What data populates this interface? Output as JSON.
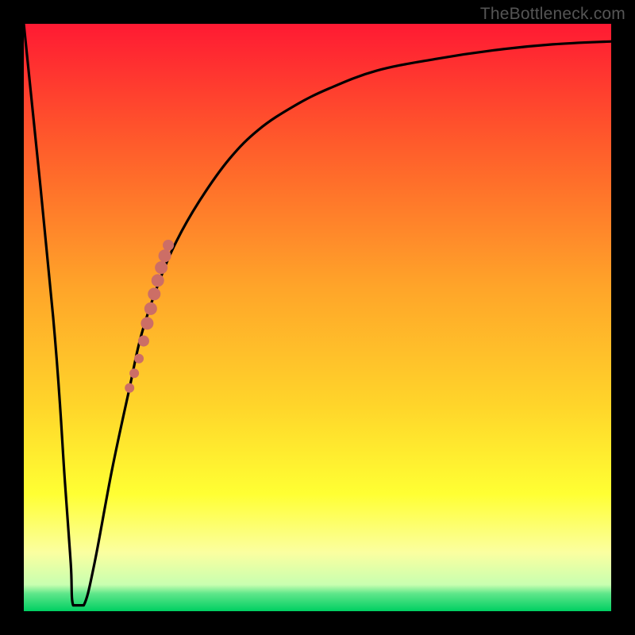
{
  "watermark": "TheBottleneck.com",
  "colors": {
    "frame": "#000000",
    "curve": "#000000",
    "markers": "#cc6e66",
    "gradient_stops": [
      {
        "offset": 0.0,
        "color": "#ff1a33"
      },
      {
        "offset": 0.2,
        "color": "#ff5a2b"
      },
      {
        "offset": 0.45,
        "color": "#ffa529"
      },
      {
        "offset": 0.65,
        "color": "#ffd52a"
      },
      {
        "offset": 0.8,
        "color": "#ffff33"
      },
      {
        "offset": 0.9,
        "color": "#fbffa0"
      },
      {
        "offset": 0.955,
        "color": "#c8ffb0"
      },
      {
        "offset": 0.97,
        "color": "#5fe68a"
      },
      {
        "offset": 1.0,
        "color": "#00d062"
      }
    ]
  },
  "chart_data": {
    "type": "line",
    "title": "",
    "xlabel": "",
    "ylabel": "",
    "xlim": [
      0,
      100
    ],
    "ylim": [
      0,
      100
    ],
    "series": [
      {
        "name": "bottleneck_curve",
        "x": [
          0,
          5,
          7,
          8,
          9,
          10,
          12,
          15,
          18,
          20,
          23,
          26,
          30,
          35,
          40,
          46,
          52,
          60,
          70,
          80,
          90,
          100
        ],
        "y": [
          100,
          50,
          22,
          8,
          1,
          1,
          8,
          24,
          38,
          47,
          56,
          63,
          70,
          77,
          82,
          86,
          89,
          92,
          94,
          95.5,
          96.5,
          97
        ]
      }
    ],
    "plateau": {
      "x_start": 8.4,
      "x_end": 10.2,
      "y": 1
    },
    "markers": {
      "name": "highlighted_segment",
      "points": [
        {
          "x": 18.0,
          "y": 38.0,
          "r": 6
        },
        {
          "x": 18.8,
          "y": 40.5,
          "r": 6
        },
        {
          "x": 19.6,
          "y": 43.0,
          "r": 6
        },
        {
          "x": 20.4,
          "y": 46.0,
          "r": 7
        },
        {
          "x": 21.0,
          "y": 49.0,
          "r": 8
        },
        {
          "x": 21.6,
          "y": 51.5,
          "r": 8
        },
        {
          "x": 22.2,
          "y": 54.0,
          "r": 8
        },
        {
          "x": 22.8,
          "y": 56.3,
          "r": 8
        },
        {
          "x": 23.4,
          "y": 58.5,
          "r": 8
        },
        {
          "x": 24.0,
          "y": 60.5,
          "r": 8
        },
        {
          "x": 24.6,
          "y": 62.3,
          "r": 7
        }
      ]
    }
  }
}
